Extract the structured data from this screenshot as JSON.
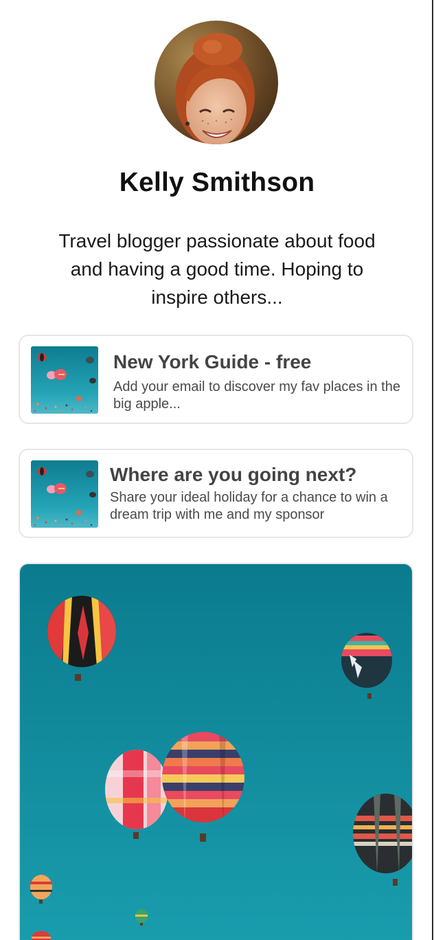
{
  "profile": {
    "name": "Kelly Smithson",
    "bio": "Travel blogger passionate about food and having a good time. Hoping to inspire others...",
    "avatar_icon": "avatar-photo"
  },
  "links": [
    {
      "title": "New York Guide - free",
      "subtitle": "Add your email to discover my fav places in the big apple...",
      "thumbnail_icon": "hot-air-balloons-thumbnail"
    },
    {
      "title": "Where are you going next?",
      "subtitle": "Share your ideal holiday for a chance to win a dream trip with me and my sponsor",
      "thumbnail_icon": "hot-air-balloons-thumbnail"
    }
  ],
  "featured": {
    "image_icon": "hot-air-balloons-photo"
  },
  "colors": {
    "sky_top": "#0b7b8e",
    "sky_bottom": "#1aa0b0",
    "card_border": "#e6e6e6",
    "title_text": "#444444"
  }
}
